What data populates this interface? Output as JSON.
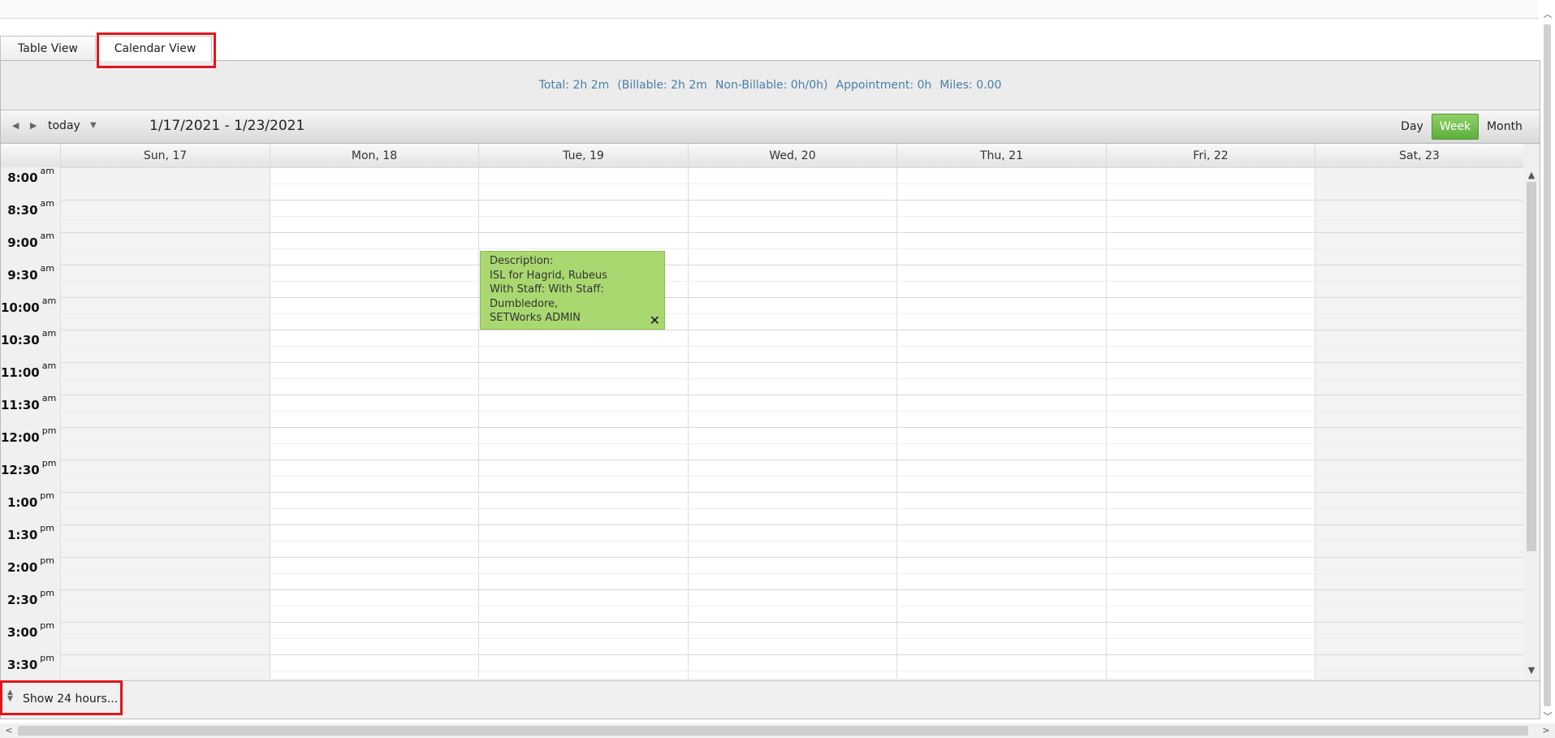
{
  "tabs": [
    {
      "label": "Table View",
      "active": false
    },
    {
      "label": "Calendar View",
      "active": true
    }
  ],
  "summary": {
    "total": "Total: 2h 2m",
    "billable": "(Billable: 2h 2m",
    "non_billable": "Non-Billable: 0h/0h)",
    "appointment": "Appointment: 0h",
    "miles": "Miles: 0.00"
  },
  "toolbar": {
    "today_label": "today",
    "date_range": "1/17/2021 - 1/23/2021",
    "views": [
      "Day",
      "Week",
      "Month"
    ],
    "active_view": "Week"
  },
  "days": [
    "Sun, 17",
    "Mon, 18",
    "Tue, 19",
    "Wed, 20",
    "Thu, 21",
    "Fri, 22",
    "Sat, 23"
  ],
  "times": [
    {
      "t": "8:00",
      "p": "am"
    },
    {
      "t": "8:30",
      "p": "am"
    },
    {
      "t": "9:00",
      "p": "am"
    },
    {
      "t": "9:30",
      "p": "am"
    },
    {
      "t": "10:00",
      "p": "am"
    },
    {
      "t": "10:30",
      "p": "am"
    },
    {
      "t": "11:00",
      "p": "am"
    },
    {
      "t": "11:30",
      "p": "am"
    },
    {
      "t": "12:00",
      "p": "pm"
    },
    {
      "t": "12:30",
      "p": "pm"
    },
    {
      "t": "1:00",
      "p": "pm"
    },
    {
      "t": "1:30",
      "p": "pm"
    },
    {
      "t": "2:00",
      "p": "pm"
    },
    {
      "t": "2:30",
      "p": "pm"
    },
    {
      "t": "3:00",
      "p": "pm"
    },
    {
      "t": "3:30",
      "p": "pm"
    }
  ],
  "event": {
    "line1": "Description:",
    "line2": "ISL for Hagrid, Rubeus",
    "line3": "With Staff: With Staff: Dumbledore,",
    "line4": "SETWorks ADMIN",
    "close_glyph": "✕",
    "color": "#aad870"
  },
  "footer": {
    "show_hours_label": "Show 24 hours..."
  },
  "colors": {
    "accent_red": "#e0161c",
    "week_green": "#5fae3c",
    "summary_blue": "#4a7fa6"
  }
}
